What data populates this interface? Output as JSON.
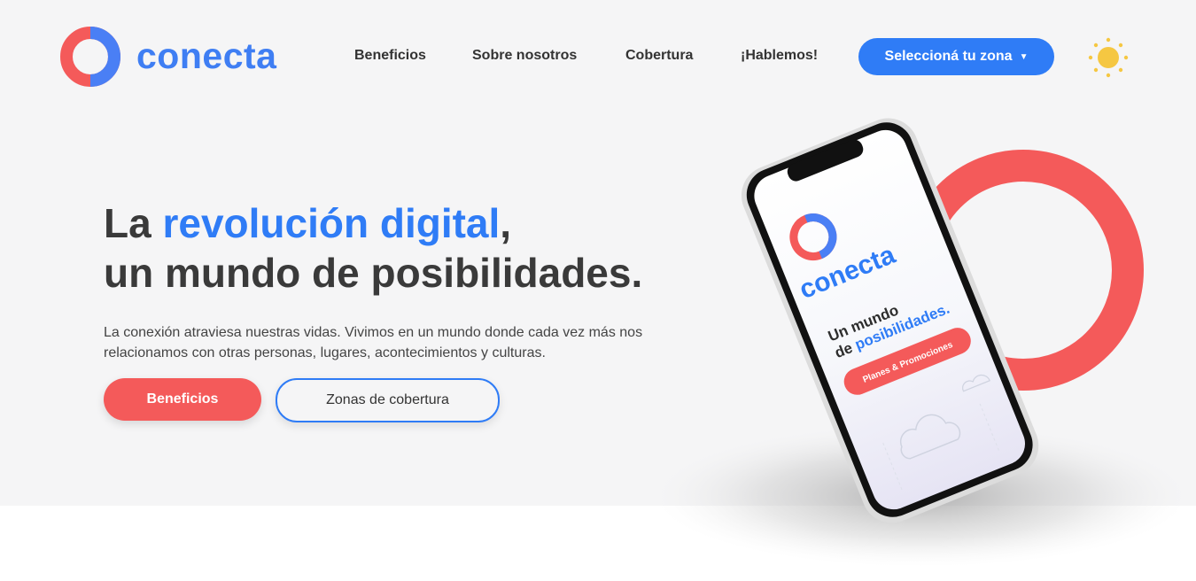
{
  "brand": {
    "name": "conecta",
    "accent": "#2f7cf6",
    "coral": "#f45a5a"
  },
  "nav": {
    "items": [
      {
        "label": "Beneficios"
      },
      {
        "label": "Sobre nosotros"
      },
      {
        "label": "Cobertura"
      },
      {
        "label": "¡Hablemos!"
      }
    ],
    "zone_button": "Seleccioná tu zona",
    "theme_icon": "sun-icon"
  },
  "hero": {
    "headline_prefix": "La ",
    "headline_accent": "revolución digital",
    "headline_comma": ",",
    "headline_line2": "un mundo de posibilidades.",
    "subtext": "La conexión atraviesa nuestras vidas. Vivimos en un mundo donde cada vez más nos relacionamos con otras personas, lugares, acontecimientos y culturas.",
    "primary_button": "Beneficios",
    "secondary_button": "Zonas de cobertura"
  },
  "phone": {
    "brand": "conecta",
    "line1": "Un mundo",
    "line2_prefix": "de ",
    "line2_accent": "posibilidades.",
    "cta": "Planes & Promociones"
  }
}
